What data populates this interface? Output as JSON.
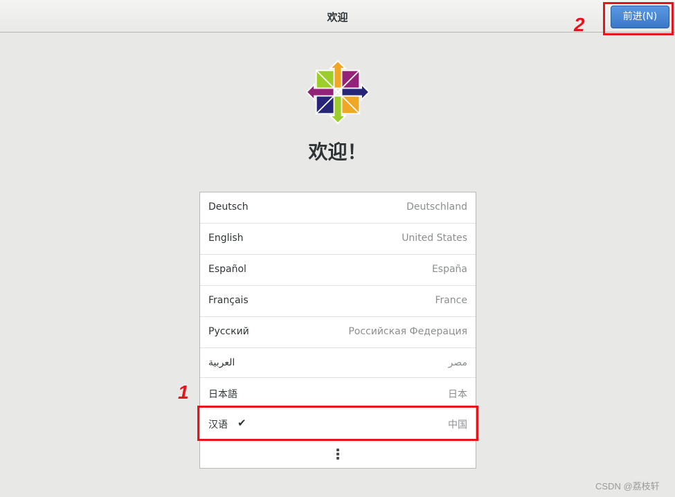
{
  "header": {
    "title": "欢迎",
    "next_label": "前进(N)"
  },
  "main": {
    "welcome": "欢迎！"
  },
  "languages": [
    {
      "name": "Deutsch",
      "region": "Deutschland"
    },
    {
      "name": "English",
      "region": "United States"
    },
    {
      "name": "Español",
      "region": "España"
    },
    {
      "name": "Français",
      "region": "France"
    },
    {
      "name": "Русский",
      "region": "Российская Федерация"
    },
    {
      "name": "العربية",
      "region": "مصر"
    },
    {
      "name": "日本語",
      "region": "日本"
    },
    {
      "name": "汉语",
      "region": "中国",
      "selected": true
    }
  ],
  "annotations": {
    "step1": "1",
    "step2": "2",
    "color": "#e8141c"
  },
  "watermark": "CSDN @荔枝轩",
  "colors": {
    "accent": "#3a78c8",
    "logo_green": "#9ccd2a",
    "logo_purple": "#932279",
    "logo_orange": "#efa724",
    "logo_navy": "#262577"
  },
  "icons": {
    "logo": "centos-logo-icon",
    "check": "checkmark-icon",
    "more": "more-vertical-icon"
  }
}
